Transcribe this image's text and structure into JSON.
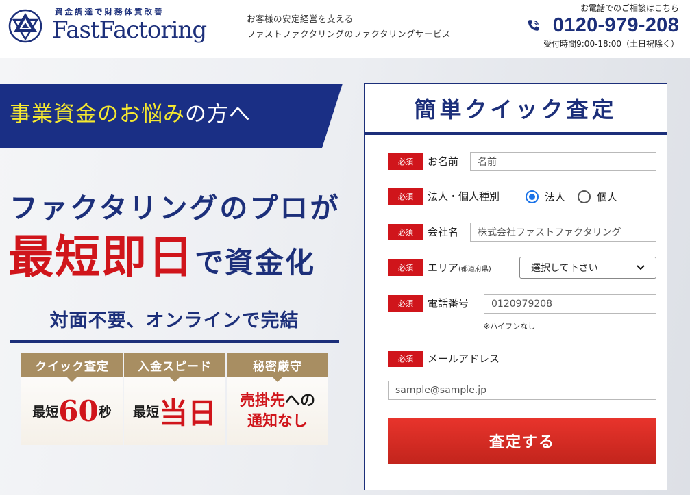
{
  "header": {
    "tagline": "資金調達で財務体質改善",
    "brand": "FastFactoring",
    "desc_line1": "お客様の安定経営を支える",
    "desc_line2": "ファストファクタリングのファクタリングサービス",
    "phone_note": "お電話でのご相談はこちら",
    "phone_number": "0120-979-208",
    "phone_hours": "受付時間9:00-18:00（土日祝除く）"
  },
  "hero": {
    "stripe_part1": "事業資金",
    "stripe_part2": "のお悩み",
    "stripe_part3": "の方へ",
    "title_line1": "ファクタリングのプロが",
    "title_big": "最短即日",
    "title_small": "で資金化",
    "subtitle": "対面不要、オンラインで完結",
    "features": [
      {
        "head": "クイック査定",
        "prefix": "最短",
        "big": "60",
        "suffix": "秒"
      },
      {
        "head": "入金スピード",
        "prefix": "最短",
        "big": "当日"
      },
      {
        "head": "秘密厳守",
        "line1_red": "売掛先",
        "line1_dark": "への",
        "line2_red": "通知なし"
      }
    ]
  },
  "form": {
    "title": "簡単クイック査定",
    "required_label": "必須",
    "name_label": "お名前",
    "name_placeholder": "名前",
    "type_label": "法人・個人種別",
    "type_options": [
      "法人",
      "個人"
    ],
    "type_selected": "法人",
    "company_label": "会社名",
    "company_placeholder": "株式会社ファストファクタリング",
    "area_label": "エリア",
    "area_note": "(都道府県)",
    "area_selected": "選択して下さい",
    "tel_label": "電話番号",
    "tel_placeholder": "0120979208",
    "tel_hint": "※ハイフンなし",
    "mail_label": "メールアドレス",
    "mail_placeholder": "sample@sample.jp",
    "submit_label": "査定する"
  },
  "colors": {
    "navy": "#1c2f7a",
    "red": "#d0151b",
    "gold": "#a88e62",
    "highlight": "#f6e92f"
  }
}
